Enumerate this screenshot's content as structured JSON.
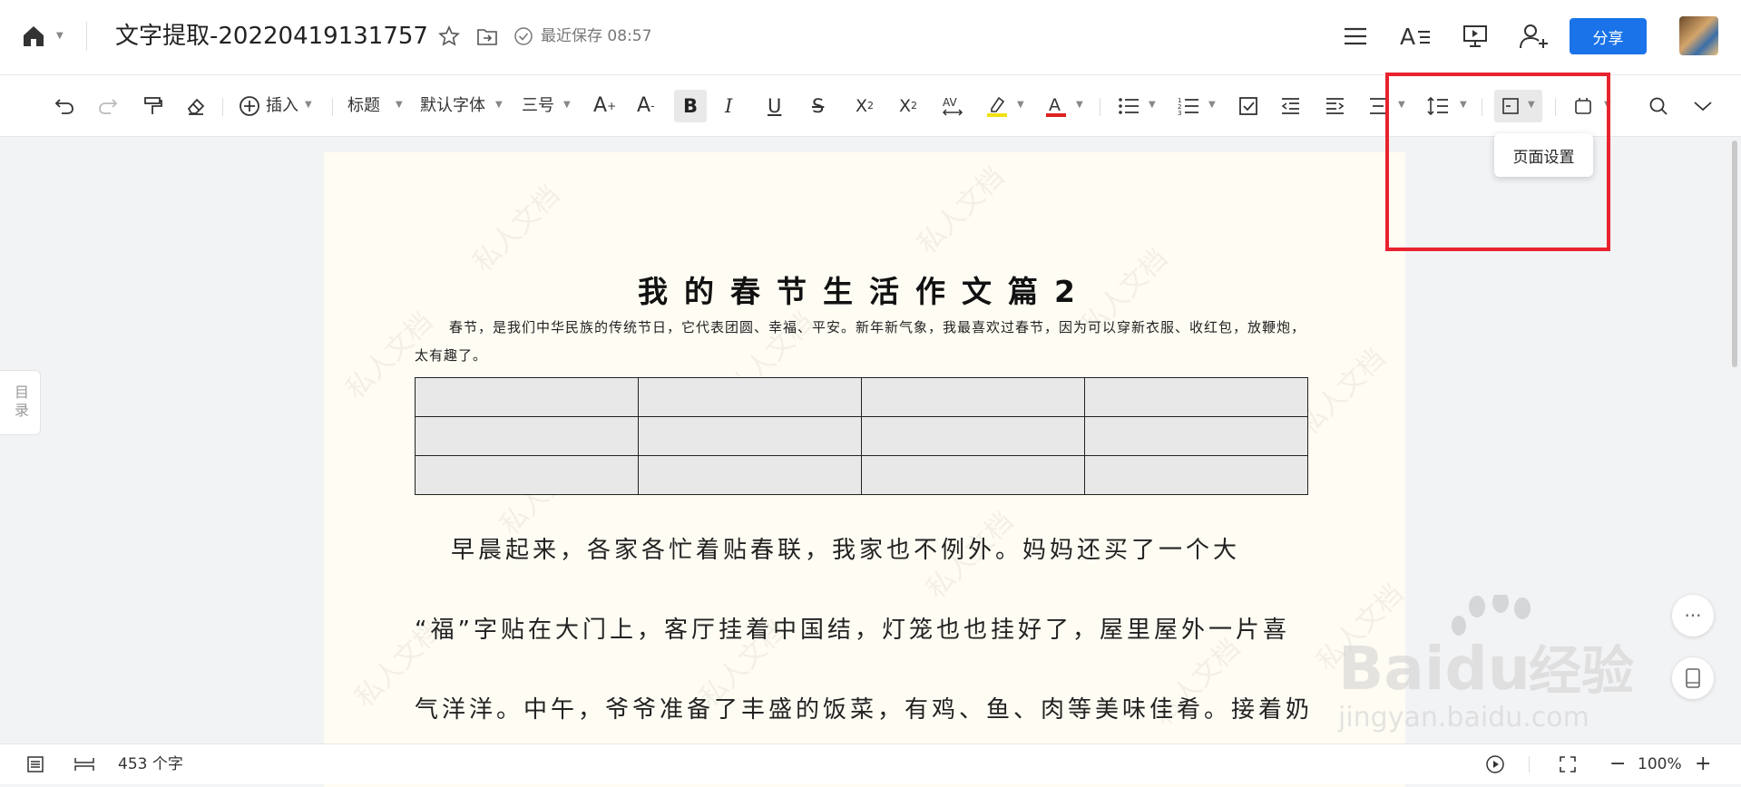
{
  "header": {
    "doc_title": "文字提取-20220419131757",
    "save_status": "最近保存 08:57",
    "share_label": "分享"
  },
  "toolbar": {
    "insert_label": "插入",
    "style_label": "标题",
    "font_label": "默认字体",
    "size_label": "三号",
    "page_settings_tooltip": "页面设置"
  },
  "sidebar": {
    "toc_label": "目录"
  },
  "document": {
    "title": "我的春节生活作文篇2",
    "intro": "春节，是我们中华民族的传统节日，它代表团圆、幸福、平安。新年新气象，我最喜欢过春节，因为可以穿新衣服、收红包，放鞭炮，太有趣了。",
    "watermark": "私人文档",
    "table": {
      "rows": 3,
      "cols": 4
    },
    "paragraphs": [
      "早晨起来，各家各忙着贴春联，我家也不例外。妈妈还买了一个大",
      "“福”字贴在大门上，客厅挂着中国结，灯笼也也挂好了，屋里屋外一片喜",
      "气洋洋。中午，爷爷准备了丰盛的饭菜，有鸡、鱼、肉等美味佳肴。接着奶"
    ]
  },
  "status_bar": {
    "word_count": "453 个字",
    "zoom": "100%"
  },
  "overlay": {
    "baidu_brand": "Baidu",
    "baidu_cn": "经验",
    "baidu_url": "jingyan.baidu.com"
  },
  "colors": {
    "accent": "#1a73e8",
    "highlight_border": "#e8232e",
    "page_bg": "#fffcf3"
  }
}
